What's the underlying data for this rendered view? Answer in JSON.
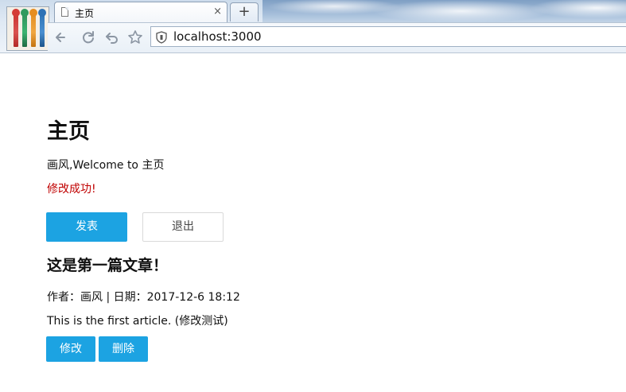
{
  "browser": {
    "tab_title": "主页",
    "tab_close": "×",
    "new_tab": "+",
    "url": "localhost:3000"
  },
  "page": {
    "title": "主页",
    "welcome": "画风,Welcome to 主页",
    "success_message": "修改成功!",
    "publish_label": "发表",
    "logout_label": "退出"
  },
  "article": {
    "title": "这是第一篇文章！",
    "meta": "作者：画风 | 日期：2017-12-6 18:12",
    "body": "This is the first article. (修改测试)",
    "edit_label": "修改",
    "delete_label": "删除"
  },
  "colors": {
    "primary": "#1ca3e2",
    "success_text": "#c00000"
  }
}
